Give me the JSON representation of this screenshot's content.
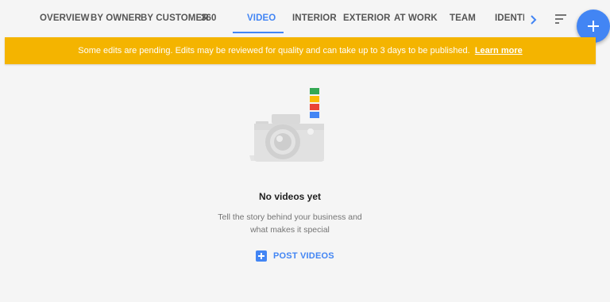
{
  "tabs": [
    {
      "label": "OVERVIEW"
    },
    {
      "label": "BY OWNER"
    },
    {
      "label": "BY CUSTOMER"
    },
    {
      "label": "360"
    },
    {
      "label": "VIDEO",
      "active": true
    },
    {
      "label": "INTERIOR"
    },
    {
      "label": "EXTERIOR"
    },
    {
      "label": "AT WORK"
    },
    {
      "label": "TEAM"
    },
    {
      "label": "IDENTITY"
    }
  ],
  "banner": {
    "message": "Some edits are pending. Edits may be reviewed for quality and can take up to 3 days to be published.",
    "link": "Learn more"
  },
  "empty_state": {
    "title": "No videos yet",
    "description_line1": "Tell the story behind your business and",
    "description_line2": "what makes it special",
    "action": "POST VIDEOS"
  },
  "icons": {
    "next": "chevron-right-icon",
    "sort": "sort-icon",
    "fab": "add-icon",
    "action": "add-box-icon",
    "illustration": "camera-illustration"
  },
  "colors": {
    "accent": "#4285f4",
    "banner": "#f4b400",
    "background": "#f5f5f5",
    "illustration_strips": [
      "#34a853",
      "#fbbc05",
      "#ea4335",
      "#4285f4"
    ]
  }
}
